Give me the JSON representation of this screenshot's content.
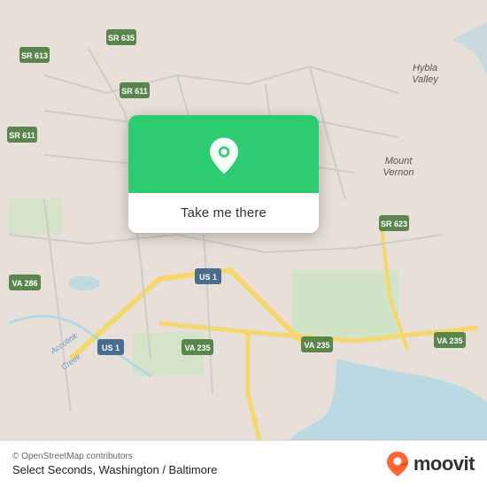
{
  "map": {
    "background_color": "#e8e0d8",
    "attribution": "© OpenStreetMap contributors",
    "location_name": "Select Seconds, Washington / Baltimore"
  },
  "popup": {
    "button_label": "Take me there",
    "pin_icon": "location-pin"
  },
  "moovit": {
    "logo_text": "moovit",
    "pin_color_top": "#ff6b35",
    "pin_color_bottom": "#e63f00"
  },
  "roads": {
    "sr613": "SR 613",
    "sr635": "SR 635",
    "sr611": "SR 611",
    "sr611b": "SR 611",
    "va286": "VA 286",
    "us1a": "US 1",
    "us1b": "US 1",
    "va235a": "VA 235",
    "va235b": "VA 235",
    "va235c": "VA 235",
    "sr623": "SR 623",
    "hybla_valley": "Hybla Valley",
    "mount_vernon": "Mount Vernon",
    "accotink_creek": "Accotink Creek"
  }
}
